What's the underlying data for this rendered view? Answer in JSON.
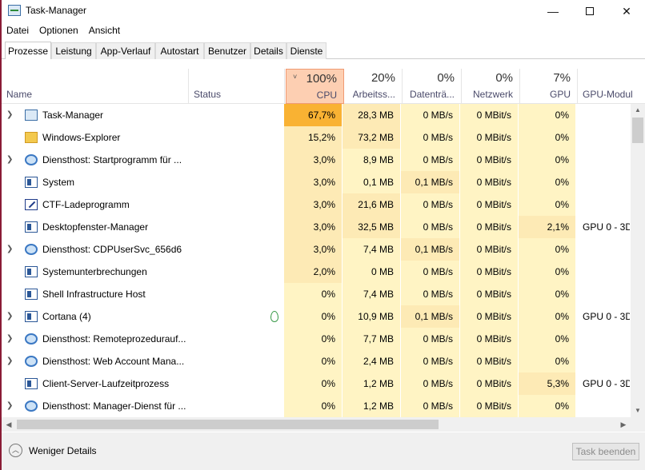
{
  "window": {
    "title": "Task-Manager",
    "minimize": "—",
    "close": "✕"
  },
  "menu": [
    "Datei",
    "Optionen",
    "Ansicht"
  ],
  "tabs": [
    "Prozesse",
    "Leistung",
    "App-Verlauf",
    "Autostart",
    "Benutzer",
    "Details",
    "Dienste"
  ],
  "columns": {
    "name": {
      "label": "Name"
    },
    "status": {
      "label": "Status"
    },
    "cpu": {
      "pct": "100%",
      "label": "CPU",
      "sort_arrow": "˅"
    },
    "mem": {
      "pct": "20%",
      "label": "Arbeitss..."
    },
    "disk": {
      "pct": "0%",
      "label": "Datenträ..."
    },
    "net": {
      "pct": "0%",
      "label": "Netzwerk"
    },
    "gpu": {
      "pct": "7%",
      "label": "GPU"
    },
    "gpuengine": {
      "label": "GPU-Modul"
    }
  },
  "processes": [
    {
      "name": "Task-Manager",
      "expandable": true,
      "icon": "task-manager-icon",
      "status": "",
      "cpu": "67,7%",
      "mem": "28,3 MB",
      "disk": "0 MB/s",
      "net": "0 MBit/s",
      "gpu": "0%",
      "engine": ""
    },
    {
      "name": "Windows-Explorer",
      "expandable": false,
      "icon": "folder-icon",
      "status": "",
      "cpu": "15,2%",
      "mem": "73,2 MB",
      "disk": "0 MB/s",
      "net": "0 MBit/s",
      "gpu": "0%",
      "engine": ""
    },
    {
      "name": "Diensthost: Startprogramm für ...",
      "expandable": true,
      "icon": "gear-icon",
      "status": "",
      "cpu": "3,0%",
      "mem": "8,9 MB",
      "disk": "0 MB/s",
      "net": "0 MBit/s",
      "gpu": "0%",
      "engine": ""
    },
    {
      "name": "System",
      "expandable": false,
      "icon": "window-icon",
      "status": "",
      "cpu": "3,0%",
      "mem": "0,1 MB",
      "disk": "0,1 MB/s",
      "net": "0 MBit/s",
      "gpu": "0%",
      "engine": ""
    },
    {
      "name": "CTF-Ladeprogramm",
      "expandable": false,
      "icon": "pen-icon",
      "status": "",
      "cpu": "3,0%",
      "mem": "21,6 MB",
      "disk": "0 MB/s",
      "net": "0 MBit/s",
      "gpu": "0%",
      "engine": ""
    },
    {
      "name": "Desktopfenster-Manager",
      "expandable": false,
      "icon": "window-icon",
      "status": "",
      "cpu": "3,0%",
      "mem": "32,5 MB",
      "disk": "0 MB/s",
      "net": "0 MBit/s",
      "gpu": "2,1%",
      "engine": "GPU 0 - 3D"
    },
    {
      "name": "Diensthost: CDPUserSvc_656d6",
      "expandable": true,
      "icon": "gear-icon",
      "status": "",
      "cpu": "3,0%",
      "mem": "7,4 MB",
      "disk": "0,1 MB/s",
      "net": "0 MBit/s",
      "gpu": "0%",
      "engine": ""
    },
    {
      "name": "Systemunterbrechungen",
      "expandable": false,
      "icon": "window-icon",
      "status": "",
      "cpu": "2,0%",
      "mem": "0 MB",
      "disk": "0 MB/s",
      "net": "0 MBit/s",
      "gpu": "0%",
      "engine": ""
    },
    {
      "name": "Shell Infrastructure Host",
      "expandable": false,
      "icon": "window-icon",
      "status": "",
      "cpu": "0%",
      "mem": "7,4 MB",
      "disk": "0 MB/s",
      "net": "0 MBit/s",
      "gpu": "0%",
      "engine": ""
    },
    {
      "name": "Cortana (4)",
      "expandable": true,
      "icon": "window-icon",
      "status": "",
      "suspended_leaf": true,
      "cpu": "0%",
      "mem": "10,9 MB",
      "disk": "0,1 MB/s",
      "net": "0 MBit/s",
      "gpu": "0%",
      "engine": "GPU 0 - 3D"
    },
    {
      "name": "Diensthost: Remoteprozedurauf...",
      "expandable": true,
      "icon": "gear-icon",
      "status": "",
      "cpu": "0%",
      "mem": "7,7 MB",
      "disk": "0 MB/s",
      "net": "0 MBit/s",
      "gpu": "0%",
      "engine": ""
    },
    {
      "name": "Diensthost: Web Account Mana...",
      "expandable": true,
      "icon": "gear-icon",
      "status": "",
      "cpu": "0%",
      "mem": "2,4 MB",
      "disk": "0 MB/s",
      "net": "0 MBit/s",
      "gpu": "0%",
      "engine": ""
    },
    {
      "name": "Client-Server-Laufzeitprozess",
      "expandable": false,
      "icon": "window-icon",
      "status": "",
      "cpu": "0%",
      "mem": "1,2 MB",
      "disk": "0 MB/s",
      "net": "0 MBit/s",
      "gpu": "5,3%",
      "engine": "GPU 0 - 3D"
    },
    {
      "name": "Diensthost: Manager-Dienst für ...",
      "expandable": true,
      "icon": "gear-icon",
      "status": "",
      "cpu": "0%",
      "mem": "1,2 MB",
      "disk": "0 MB/s",
      "net": "0 MBit/s",
      "gpu": "0%",
      "engine": ""
    }
  ],
  "footer": {
    "fewer_details": "Weniger Details",
    "end_task": "Task beenden"
  },
  "colors": {
    "accent_border": "#8a1c36",
    "cpu_header": "#fdcfb2",
    "heat_high": "#f9b233",
    "heat_mid": "#fdeab5",
    "heat_low": "#fff4c4"
  }
}
